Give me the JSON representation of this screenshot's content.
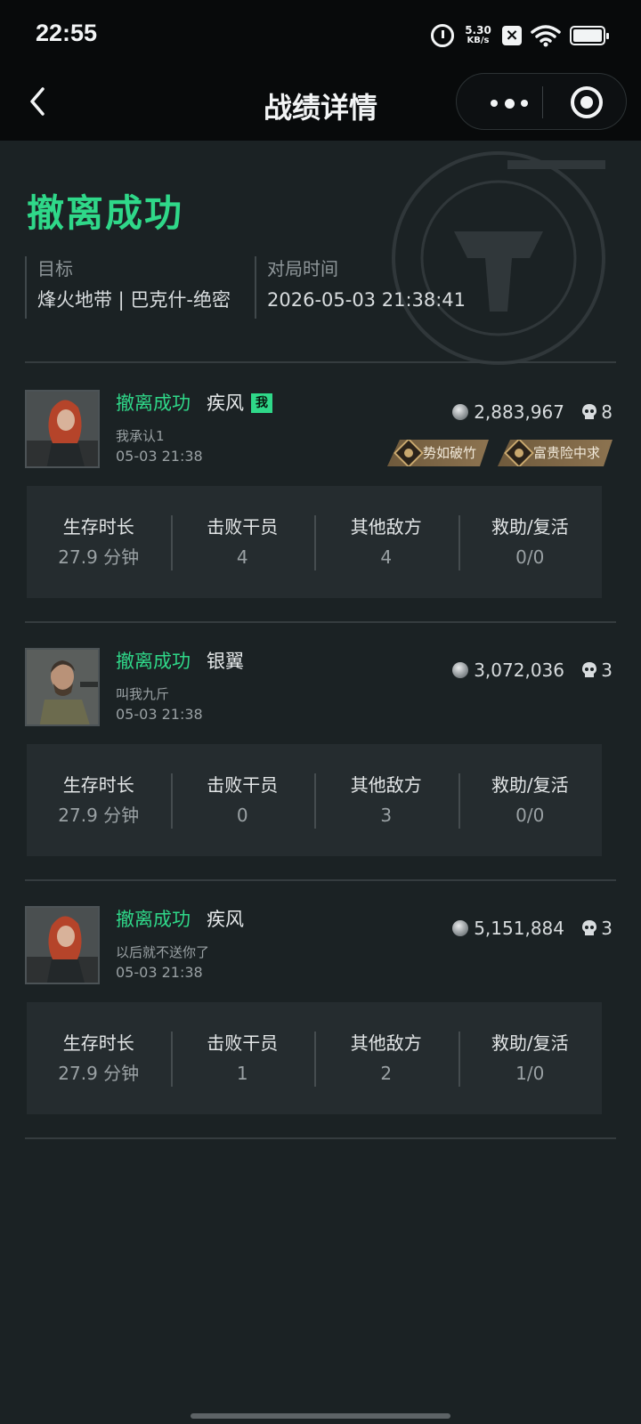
{
  "status_bar": {
    "time": "22:55",
    "net_speed_value": "5.30",
    "net_speed_unit": "KB/s",
    "icons": [
      "alarm-icon",
      "no-sim-icon",
      "wifi-icon",
      "battery-icon"
    ]
  },
  "header": {
    "title": "战绩详情",
    "icons": [
      "back-chevron-icon",
      "more-dots-icon",
      "target-circle-icon"
    ]
  },
  "summary": {
    "result": "撤离成功",
    "target_label": "目标",
    "target_value": "烽火地带 | 巴克什-绝密",
    "time_label": "对局时间",
    "time_value": "2026-05-03 21:38:41"
  },
  "stat_labels": {
    "survive": "生存时长",
    "defeated": "击败干员",
    "others": "其他敌方",
    "assist": "救助/复活"
  },
  "players": [
    {
      "status": "撤离成功",
      "operator": "疾风",
      "me_badge": "我",
      "nickname": "我承认1",
      "time": "05-03 21:38",
      "money": "2,883,967",
      "kills": "8",
      "badges": [
        "势如破竹",
        "富贵险中求"
      ],
      "stats": {
        "survive": "27.9 分钟",
        "defeated": "4",
        "others": "4",
        "assist": "0/0"
      }
    },
    {
      "status": "撤离成功",
      "operator": "银翼",
      "nickname": "叫我九斤",
      "time": "05-03 21:38",
      "money": "3,072,036",
      "kills": "3",
      "stats": {
        "survive": "27.9 分钟",
        "defeated": "0",
        "others": "3",
        "assist": "0/0"
      }
    },
    {
      "status": "撤离成功",
      "operator": "疾风",
      "nickname": "以后就不送你了",
      "time": "05-03 21:38",
      "money": "5,151,884",
      "kills": "3",
      "stats": {
        "survive": "27.9 分钟",
        "defeated": "1",
        "others": "2",
        "assist": "1/0"
      }
    }
  ],
  "colors": {
    "accent_green": "#2fd889",
    "background": "#1b2224",
    "header_bg": "#080a0b",
    "badge_gold": "#8c7350"
  }
}
